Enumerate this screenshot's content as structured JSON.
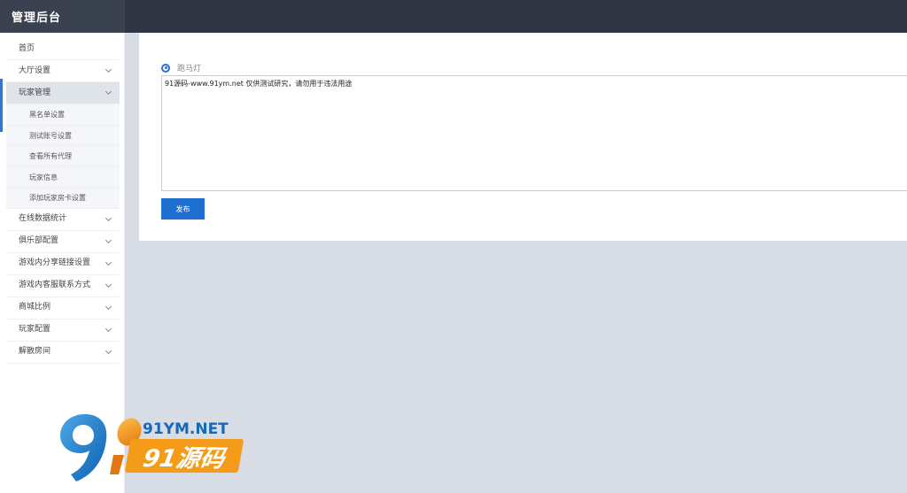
{
  "header": {
    "title": "管理后台"
  },
  "sidebar": {
    "items": [
      {
        "label": "首页",
        "expandable": false
      },
      {
        "label": "大厅设置",
        "expandable": true
      },
      {
        "label": "玩家管理",
        "expandable": true,
        "active": true
      },
      {
        "label": "在线数据统计",
        "expandable": true
      },
      {
        "label": "俱乐部配置",
        "expandable": true
      },
      {
        "label": "游戏内分享链接设置",
        "expandable": true
      },
      {
        "label": "游戏内客服联系方式",
        "expandable": true
      },
      {
        "label": "商城比例",
        "expandable": true
      },
      {
        "label": "玩家配置",
        "expandable": true
      },
      {
        "label": "解散房间",
        "expandable": true
      }
    ],
    "sub_items": [
      {
        "label": "黑名单设置"
      },
      {
        "label": "测试账号设置"
      },
      {
        "label": "查看所有代理"
      },
      {
        "label": "玩家信息"
      },
      {
        "label": "添加玩家房卡设置"
      }
    ]
  },
  "main": {
    "radio_label": "跑马灯",
    "textarea_value": "91源码-www.91ym.net 仅供测试研究，请勿用于违法用途",
    "publish_label": "发布"
  },
  "watermark": {
    "top_text": "91YM.NET",
    "bottom_text": "91源码",
    "colors": {
      "blue": "#1668b8",
      "orange": "#f49c1a"
    }
  },
  "colors": {
    "topbar": "#2f3542",
    "accent": "#1f6fd1",
    "background": "#d8dce5"
  }
}
